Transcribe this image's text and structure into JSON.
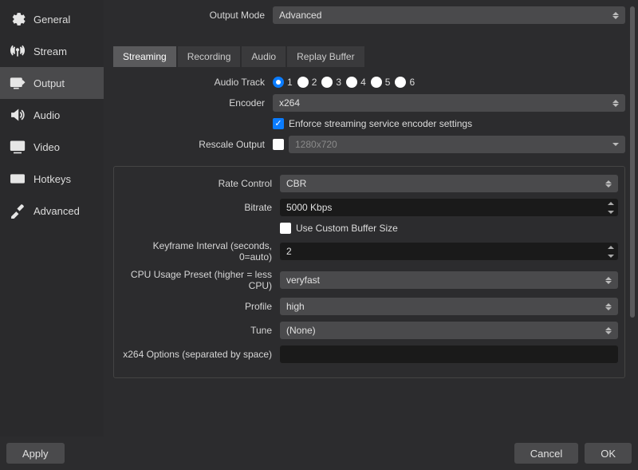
{
  "sidebar": {
    "items": [
      {
        "label": "General"
      },
      {
        "label": "Stream"
      },
      {
        "label": "Output"
      },
      {
        "label": "Audio"
      },
      {
        "label": "Video"
      },
      {
        "label": "Hotkeys"
      },
      {
        "label": "Advanced"
      }
    ]
  },
  "header": {
    "output_mode_label": "Output Mode",
    "output_mode_value": "Advanced"
  },
  "tabs": {
    "streaming": "Streaming",
    "recording": "Recording",
    "audio": "Audio",
    "replay": "Replay Buffer"
  },
  "form": {
    "audio_track_label": "Audio Track",
    "tracks": [
      "1",
      "2",
      "3",
      "4",
      "5",
      "6"
    ],
    "encoder_label": "Encoder",
    "encoder_value": "x264",
    "enforce_label": "Enforce streaming service encoder settings",
    "rescale_label": "Rescale Output",
    "rescale_value": "1280x720",
    "rate_control_label": "Rate Control",
    "rate_control_value": "CBR",
    "bitrate_label": "Bitrate",
    "bitrate_value": "5000 Kbps",
    "custom_buffer_label": "Use Custom Buffer Size",
    "keyframe_label": "Keyframe Interval (seconds, 0=auto)",
    "keyframe_value": "2",
    "cpu_preset_label": "CPU Usage Preset (higher = less CPU)",
    "cpu_preset_value": "veryfast",
    "profile_label": "Profile",
    "profile_value": "high",
    "tune_label": "Tune",
    "tune_value": "(None)",
    "x264_opts_label": "x264 Options (separated by space)",
    "x264_opts_value": ""
  },
  "footer": {
    "apply": "Apply",
    "cancel": "Cancel",
    "ok": "OK"
  }
}
